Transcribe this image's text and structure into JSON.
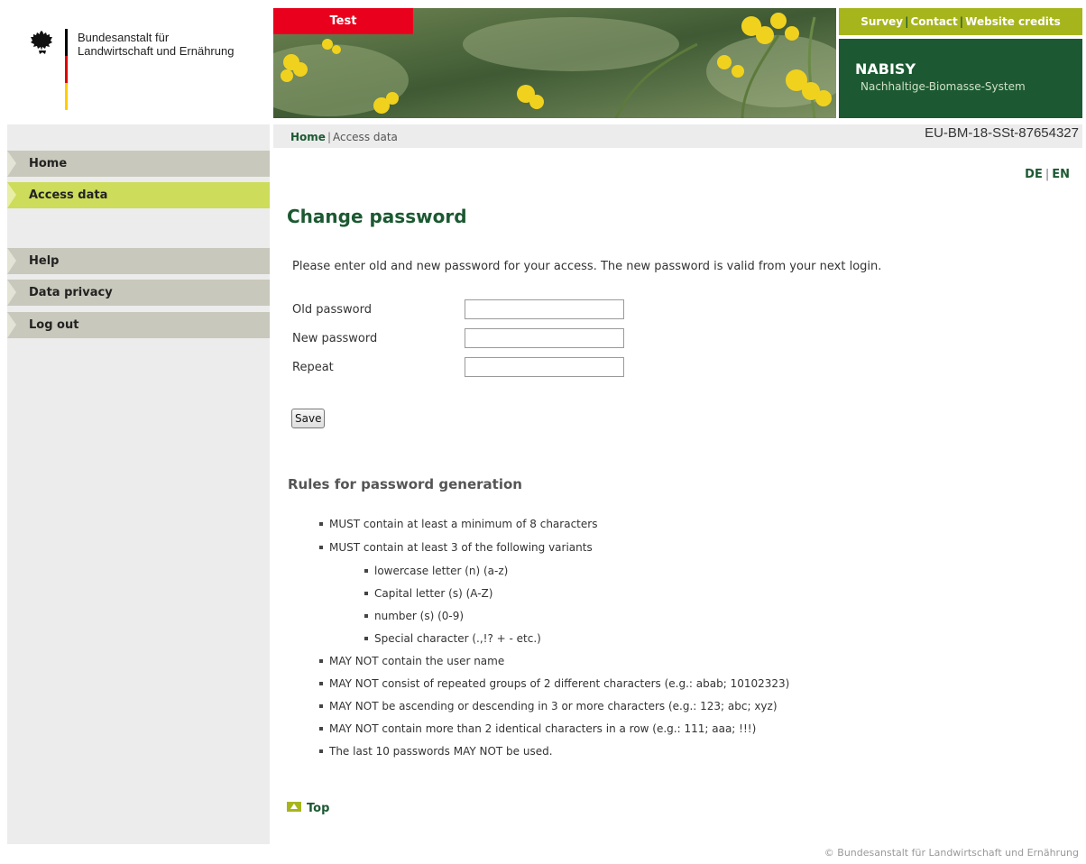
{
  "header": {
    "org_line1": "Bundesanstalt für",
    "org_line2": "Landwirtschaft und Ernährung",
    "test_label": "Test",
    "topnav": [
      "Survey",
      "Contact",
      "Website credits"
    ],
    "brand_name": "NABISY",
    "brand_sub": "Nachhaltige-Biomasse-System"
  },
  "breadcrumb": {
    "home": "Home",
    "current": "Access data"
  },
  "id_code": "EU-BM-18-SSt-87654327",
  "sidebar": {
    "items": [
      "Home",
      "Access data",
      "Help",
      "Data privacy",
      "Log out"
    ],
    "active": "Access data"
  },
  "lang": {
    "de": "DE",
    "en": "EN"
  },
  "main": {
    "title": "Change password",
    "intro": "Please enter old and new password for your access. The new password is valid from your next login.",
    "fields": [
      "Old password",
      "New password",
      "Repeat"
    ],
    "save_label": "Save",
    "rules_title": "Rules for password generation",
    "rules": [
      "MUST contain at least a minimum of 8 characters",
      "MUST contain at least 3 of the following variants",
      "lowercase letter (n) (a-z)",
      "Capital letter (s) (A-Z)",
      "number (s) (0-9)",
      "Special character (.,!? + - etc.)",
      "MAY NOT contain the user name",
      "MAY NOT consist of repeated groups of 2 different characters (e.g.: abab; 10102323)",
      "MAY NOT be ascending or descending in 3 or more characters (e.g.: 123; abc; xyz)",
      "MAY NOT contain more than 2 identical characters in a row (e.g.: 111; aaa; !!!)",
      "The last 10 passwords MAY NOT be used."
    ],
    "top_label": "Top"
  },
  "footer": "© Bundesanstalt für Landwirtschaft und Ernährung",
  "colors": {
    "green": "#1c5932",
    "lime": "#a7b51d",
    "red": "#e8001c",
    "active_nav": "#cddc5a"
  }
}
